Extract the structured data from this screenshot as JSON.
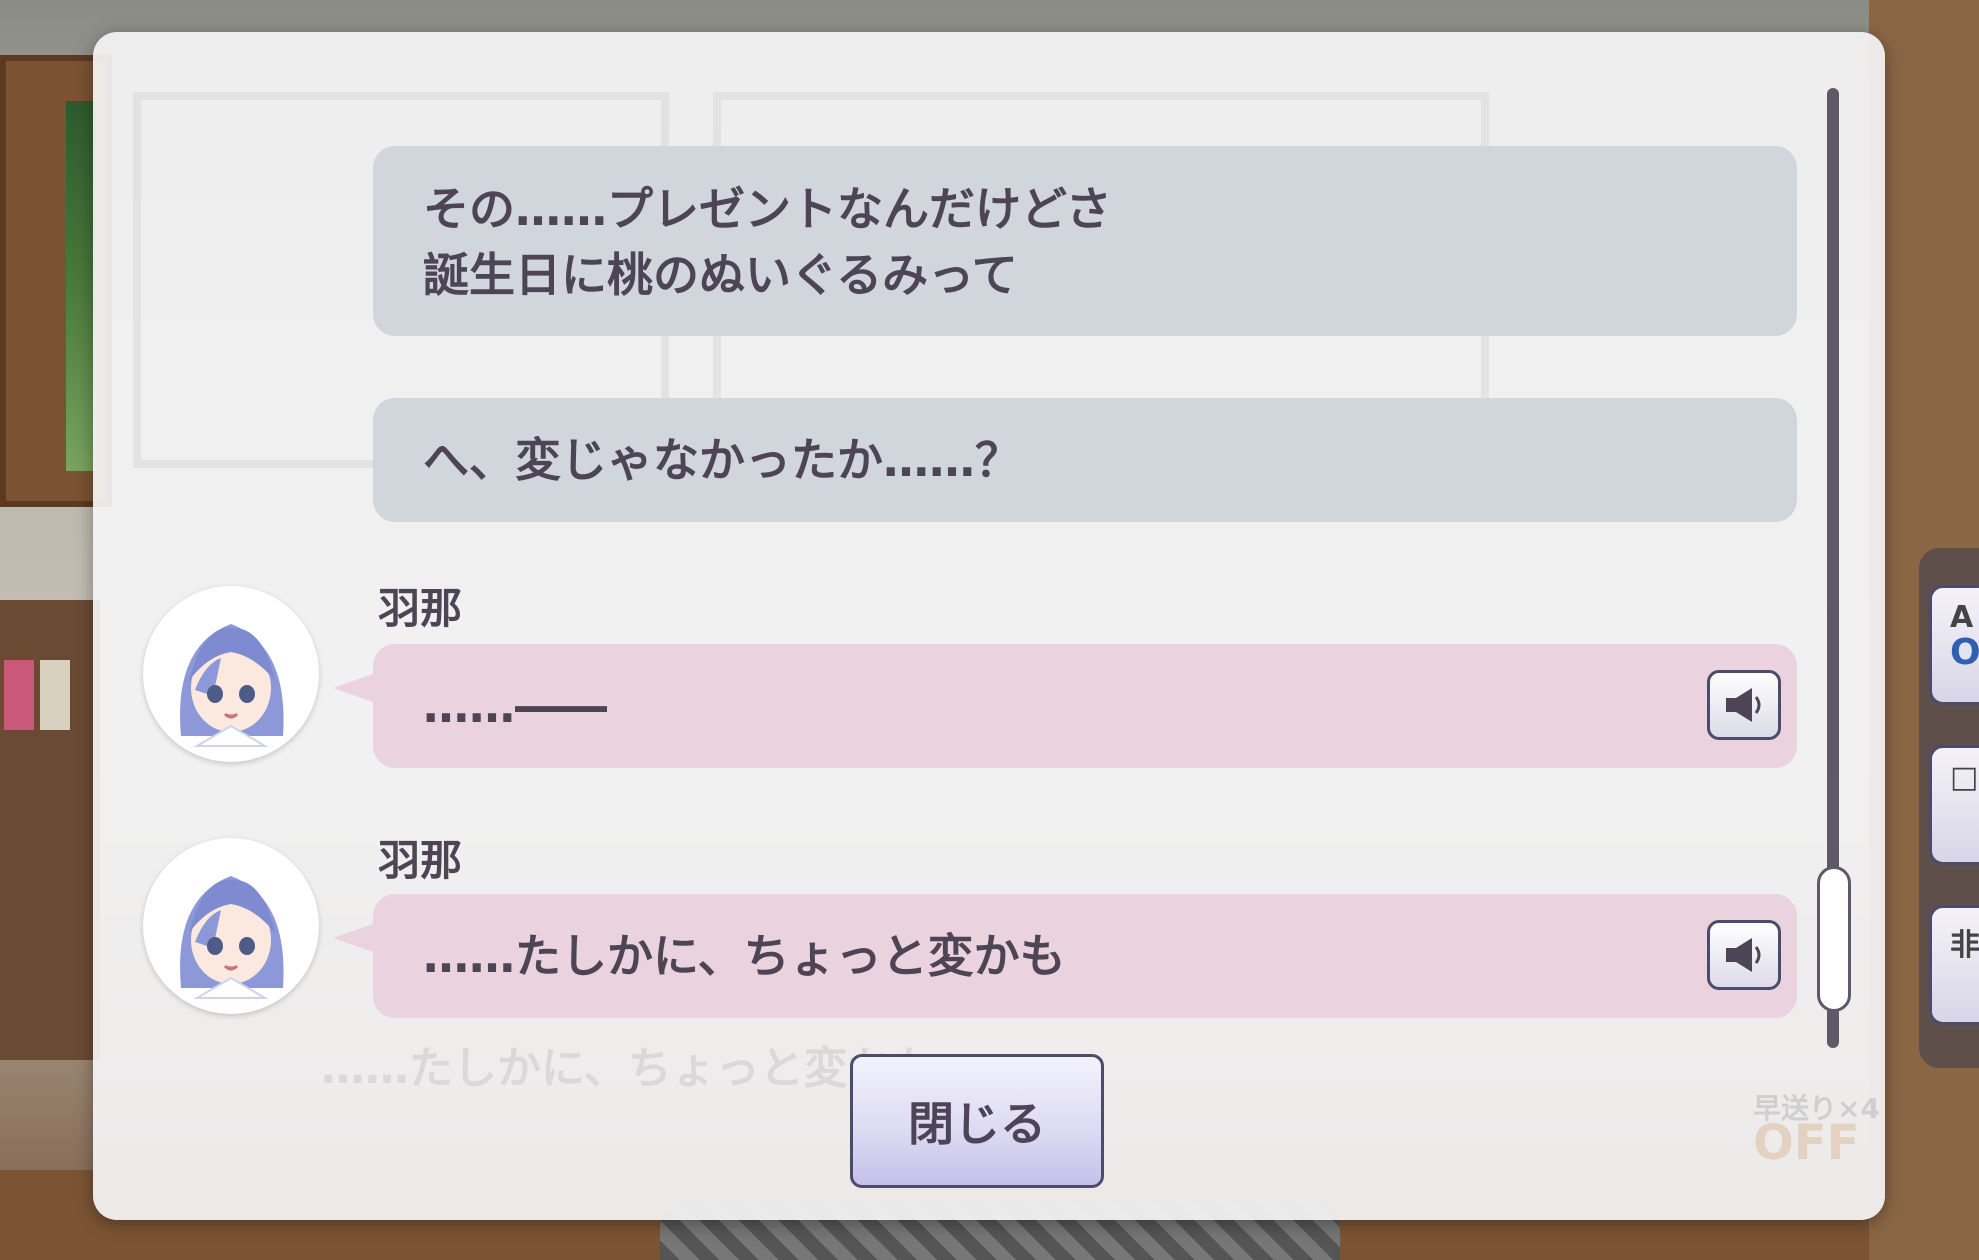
{
  "backlog": {
    "entries": [
      {
        "type": "narration",
        "lines": [
          "その……プレゼントなんだけどさ",
          "誕生日に桃のぬいぐるみって"
        ]
      },
      {
        "type": "narration",
        "lines": [
          "へ、変じゃなかったか……？"
        ]
      },
      {
        "type": "dialogue",
        "speaker": "羽那",
        "lines": [
          "……――"
        ],
        "voice_icon": "speaker-icon"
      },
      {
        "type": "dialogue",
        "speaker": "羽那",
        "lines": [
          "……たしかに、ちょっと変かも"
        ],
        "voice_icon": "speaker-icon"
      }
    ],
    "close_label": "閉じる",
    "faded_text": "……たしかに、ちょっと変かも",
    "fast_forward": {
      "label": "早送り×4",
      "state": "OFF"
    }
  },
  "side_menu": [
    {
      "label": "A",
      "sub": "O"
    },
    {
      "label": "□",
      "sub": ""
    },
    {
      "label": "非",
      "sub": ""
    }
  ],
  "colors": {
    "narration_bubble": "#d1d5dc",
    "dialogue_bubble": "#ead2de",
    "text": "#4d4455",
    "accent_border": "#4b4b6b"
  }
}
